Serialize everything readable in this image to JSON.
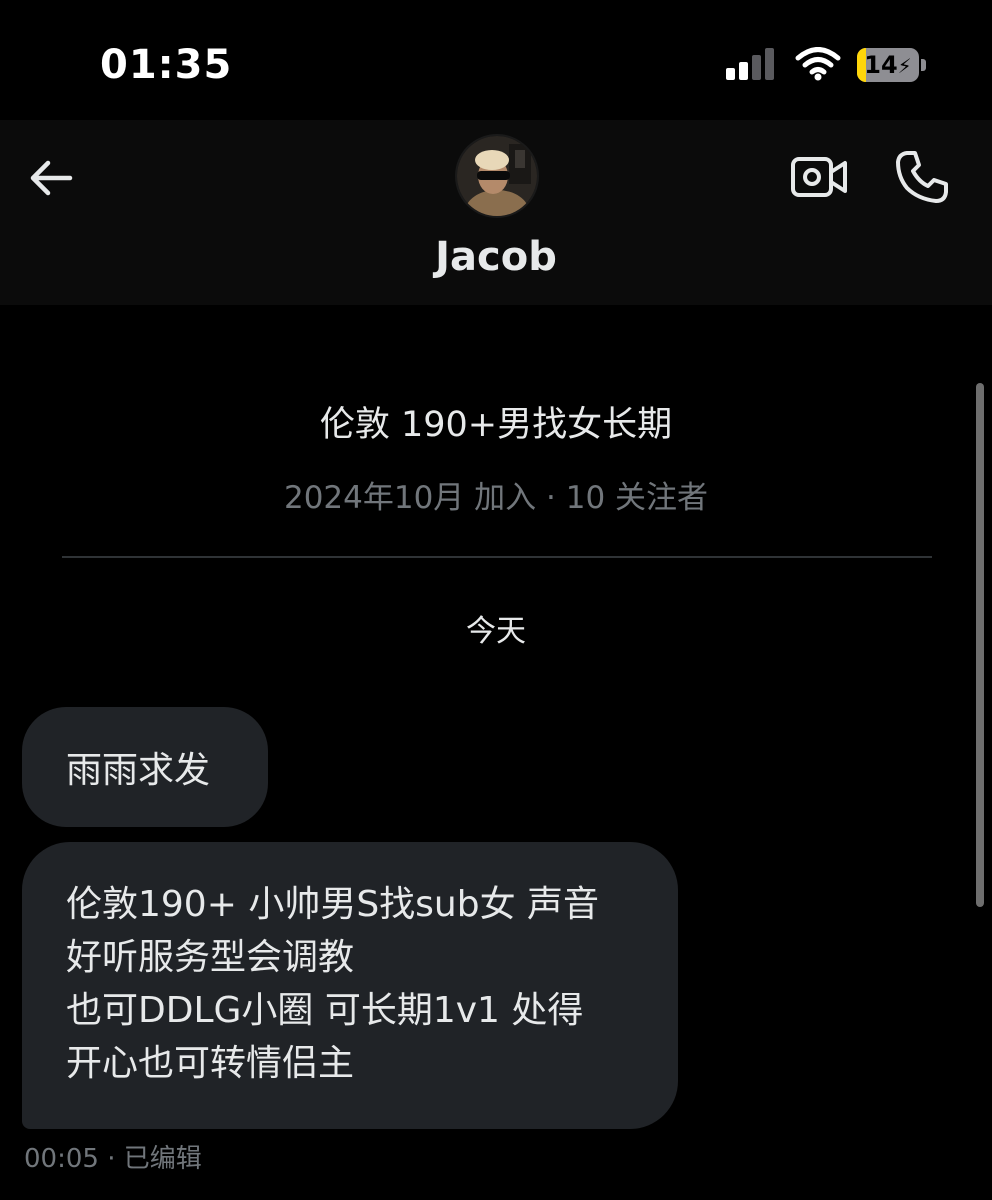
{
  "status_bar": {
    "time": "01:35",
    "battery": "14",
    "battery_level": 0.14,
    "battery_charging": true,
    "icons": [
      "cellular-signal-icon",
      "wifi-icon",
      "battery-charging-icon"
    ]
  },
  "header": {
    "contact_name": "Jacob",
    "icons": [
      "back-arrow-icon",
      "avatar",
      "video-call-icon",
      "phone-call-icon"
    ]
  },
  "profile": {
    "bio": "伦敦 190+男找女长期",
    "meta": "2024年10月 加入 · 10 关注者"
  },
  "conversation": {
    "date_separator": "今天",
    "messages": [
      {
        "lines": [
          "雨雨求发"
        ]
      },
      {
        "lines": [
          "伦敦190+ 小帅男S找sub女 声音",
          "好听服务型会调教",
          "也可DDLG小圈 可长期1v1 处得",
          "开心也可转情侣主"
        ]
      }
    ],
    "last_meta": "00:05 · 已编辑"
  },
  "colors": {
    "background": "#000000",
    "header_bg": "#0b0b0b",
    "bubble": "#202327",
    "text_primary": "#e7e9ea",
    "text_secondary": "#71767b",
    "battery_fill": "#ffd60a"
  }
}
